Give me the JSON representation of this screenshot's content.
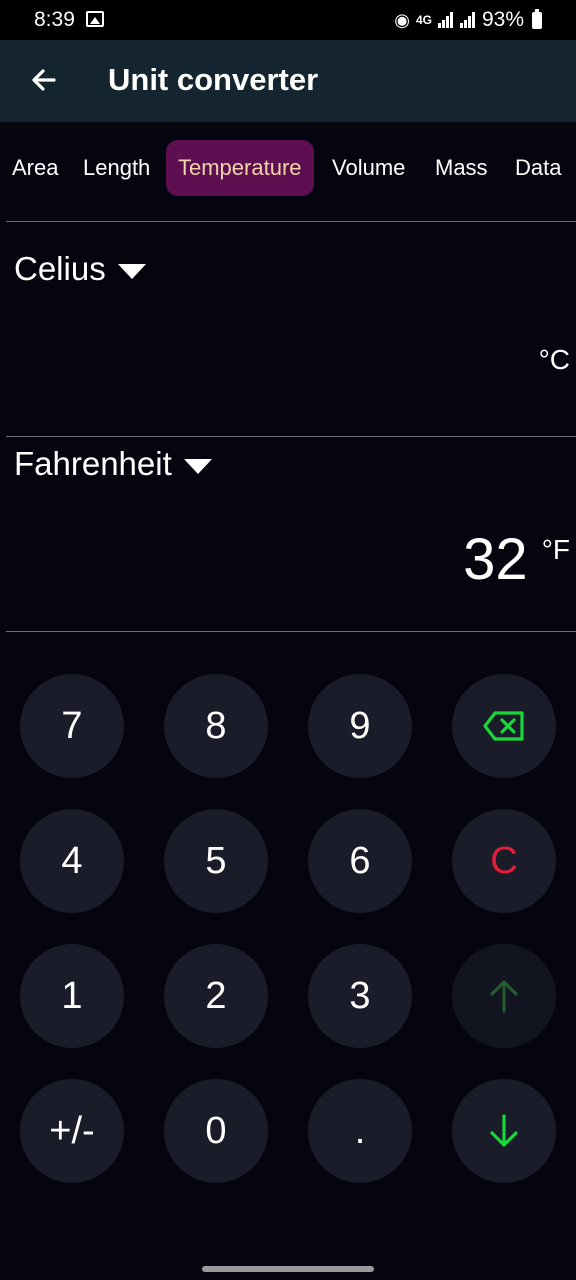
{
  "status": {
    "time": "8:39",
    "network": "4G",
    "battery": "93%"
  },
  "appbar": {
    "title": "Unit converter"
  },
  "tabs": [
    {
      "label": "Area"
    },
    {
      "label": "Length"
    },
    {
      "label": "Temperature"
    },
    {
      "label": "Volume"
    },
    {
      "label": "Mass"
    },
    {
      "label": "Data"
    }
  ],
  "active_tab": "Temperature",
  "from": {
    "unit": "Celius",
    "value": "",
    "symbol": "°C"
  },
  "to": {
    "unit": "Fahrenheit",
    "value": "32",
    "symbol": "°F"
  },
  "keypad": {
    "k7": "7",
    "k8": "8",
    "k9": "9",
    "k4": "4",
    "k5": "5",
    "k6": "6",
    "k1": "1",
    "k2": "2",
    "k3": "3",
    "plusminus": "+/-",
    "k0": "0",
    "dot": ".",
    "clear": "C"
  },
  "colors": {
    "background": "#05050f",
    "appbar": "#14252f",
    "active_tab_bg": "#5e0f52",
    "active_tab_text": "#f0d4a8",
    "key_bg": "#1a1c29",
    "clear": "#e01e3c",
    "backspace": "#19d63a",
    "down_arrow": "#19d63a",
    "up_arrow_disabled": "#235a2e"
  },
  "icons": {
    "back": "arrow-left-icon",
    "backspace": "backspace-icon",
    "up": "arrow-up-icon",
    "down": "arrow-down-icon",
    "dropdown": "triangle-down-icon"
  }
}
